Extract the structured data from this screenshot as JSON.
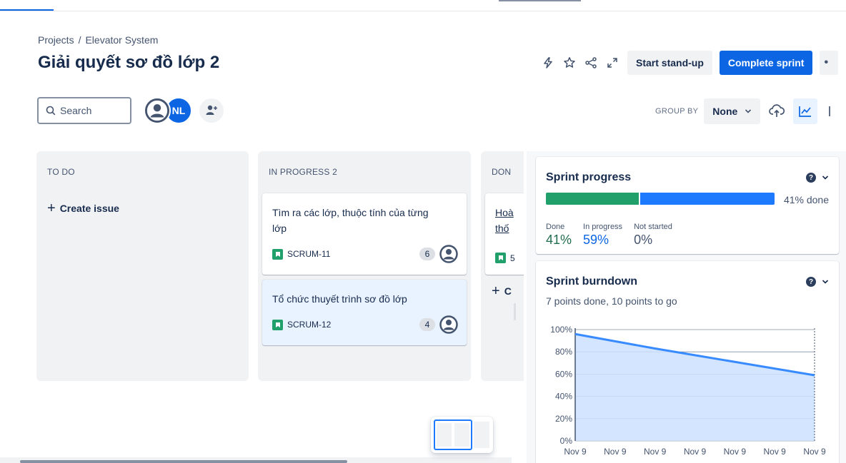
{
  "breadcrumb": {
    "root": "Projects",
    "separator": "/",
    "project": "Elevator System"
  },
  "page": {
    "title": "Giải quyết sơ đồ lớp 2"
  },
  "header_actions": {
    "automation_icon": "lightning-icon",
    "star_icon": "star-icon",
    "share_icon": "share-icon",
    "fullscreen_icon": "expand-icon",
    "standup_label": "Start stand-up",
    "complete_sprint_label": "Complete sprint"
  },
  "toolbar": {
    "search_placeholder": "Search",
    "avatar_initials": "NL",
    "group_by_label": "GROUP BY",
    "group_by_value": "None"
  },
  "columns": [
    {
      "header": "TO DO",
      "create_label": "Create issue"
    },
    {
      "header": "IN PROGRESS 2"
    },
    {
      "header": "DON",
      "create_label": "C"
    }
  ],
  "cards": [
    {
      "summary": "Tìm ra các lớp, thuộc tính của từng lớp",
      "key": "SCRUM-11",
      "points": "6"
    },
    {
      "summary": "Tổ chức thuyết trình sơ đồ lớp",
      "key": "SCRUM-12",
      "points": "4"
    },
    {
      "summary_line1": "Hoà",
      "summary_line2": "thố",
      "key": "5"
    }
  ],
  "sprint_progress": {
    "title": "Sprint progress",
    "done_fraction": 0.41,
    "in_progress_fraction": 0.59,
    "percent_label": "41% done",
    "stats": [
      {
        "label": "Done",
        "value": "41%"
      },
      {
        "label": "In progress",
        "value": "59%"
      },
      {
        "label": "Not started",
        "value": "0%"
      }
    ],
    "colors": {
      "done": "#22a06b",
      "in_progress": "#1d7afc"
    }
  },
  "sprint_burndown": {
    "title": "Sprint burndown",
    "subtitle": "7 points done, 10 points to go"
  },
  "chart_data": {
    "type": "area",
    "x": [
      "Nov 9",
      "Nov 9",
      "Nov 9",
      "Nov 9",
      "Nov 9",
      "Nov 9",
      "Nov 9"
    ],
    "y_ticks": [
      "100%",
      "80%",
      "60%",
      "40%",
      "20%",
      "0%"
    ],
    "ylim": [
      0,
      100
    ],
    "series": [
      {
        "values": [
          96,
          89.5,
          83,
          77,
          71,
          65,
          59
        ]
      }
    ],
    "colors": {
      "line": "#388bff",
      "fill": "#cce0ff"
    }
  }
}
